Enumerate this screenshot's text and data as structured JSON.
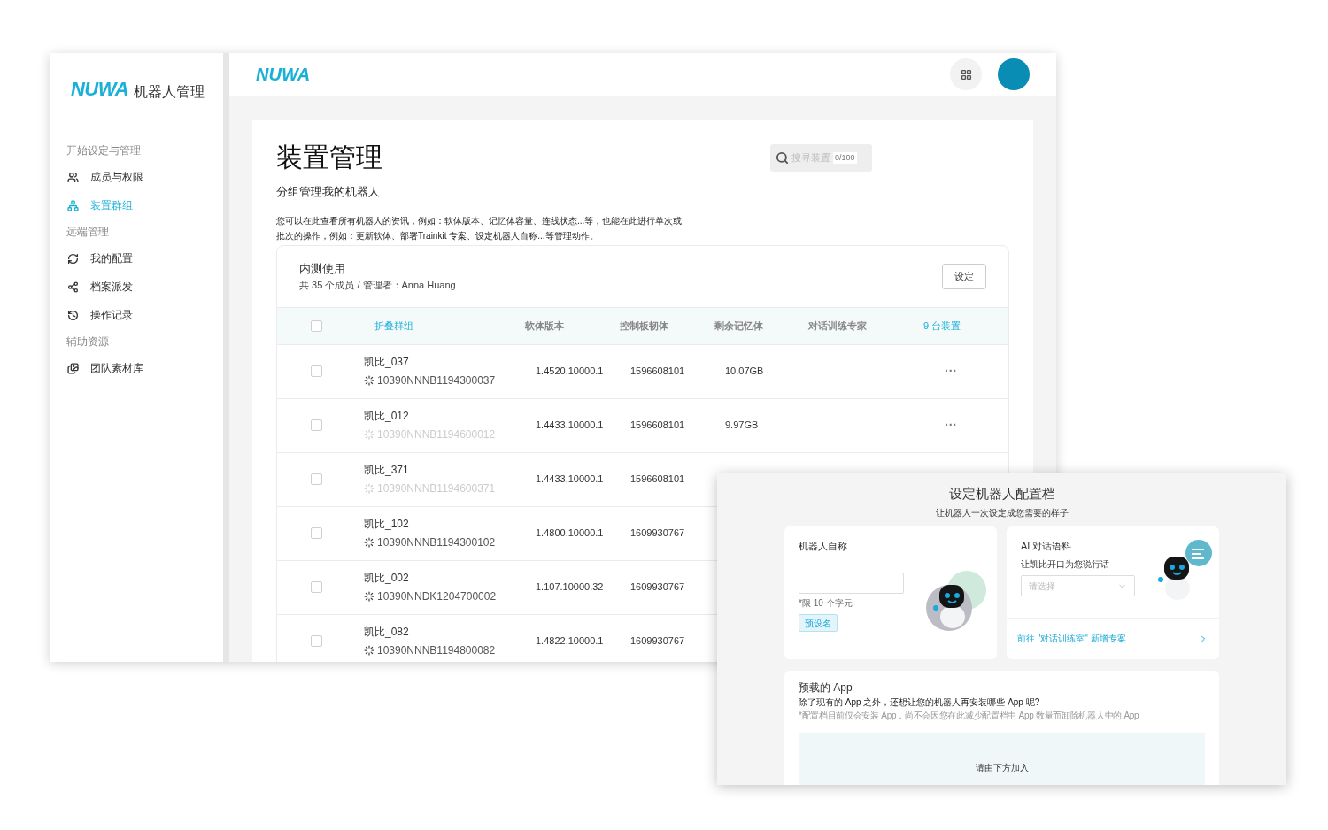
{
  "main_window": {
    "sidebar": {
      "logo": "NUWA",
      "product": "机器人管理",
      "sections": [
        {
          "title": "开始设定与管理",
          "items": [
            {
              "label": "成员与权限",
              "selected": false
            },
            {
              "label": "装置群组",
              "selected": true
            }
          ]
        },
        {
          "title": "远端管理",
          "items": [
            {
              "label": "我的配置",
              "selected": false
            },
            {
              "label": "档案派发",
              "selected": false
            },
            {
              "label": "操作记录",
              "selected": false
            }
          ]
        },
        {
          "title": "辅助资源",
          "items": [
            {
              "label": "团队素材库",
              "selected": false
            }
          ]
        }
      ]
    },
    "topbar": {
      "logo": "NUWA"
    },
    "page": {
      "title": "装置管理",
      "subtitle": "分组管理我的机器人",
      "description": [
        "您可以在此查看所有机器人的资讯，例如：软体版本、记忆体容量、连线状态...等，也能在此进行单次或",
        "批次的操作，例如：更新软体、部署Trainkit 专案、设定机器人自称...等管理动作。"
      ],
      "search": {
        "placeholder": "搜寻装置",
        "counter": "0/100"
      },
      "group": {
        "name": "内测使用",
        "meta": "共 35 个成员 / 管理者：Anna Huang",
        "button": "设定",
        "header": {
          "checked": false,
          "collapse": "折叠群组",
          "columns": [
            "软体版本",
            "控制板韧体",
            "剩余记忆体",
            "对话训练专家"
          ],
          "count": "9 台装置"
        },
        "rows": [
          {
            "checked": false,
            "name": "凯比_037",
            "device_id": "10390NNNB1194300037",
            "online": true,
            "version": "1.4520.10000.1",
            "firmware": "1596608101",
            "memory": "10.07GB",
            "more": "···"
          },
          {
            "checked": false,
            "name": "凯比_012",
            "device_id": "10390NNNB1194600012",
            "online": false,
            "version": "1.4433.10000.1",
            "firmware": "1596608101",
            "memory": "9.97GB",
            "more": "···"
          },
          {
            "checked": false,
            "name": "凯比_371",
            "device_id": "10390NNNB1194600371",
            "online": false,
            "version": "1.4433.10000.1",
            "firmware": "1596608101"
          },
          {
            "checked": false,
            "name": "凯比_102",
            "device_id": "10390NNNB1194300102",
            "online": true,
            "version": "1.4800.10000.1",
            "firmware": "1609930767"
          },
          {
            "checked": false,
            "name": "凯比_002",
            "device_id": "10390NNDK1204700002",
            "online": true,
            "version": "1.107.10000.32",
            "firmware": "1609930767"
          },
          {
            "checked": false,
            "name": "凯比_082",
            "device_id": "10390NNNB1194800082",
            "online": true,
            "version": "1.4822.10000.1",
            "firmware": "1609930767"
          }
        ]
      }
    }
  },
  "profile_window": {
    "title": "设定机器人配置档",
    "subtitle": "让机器人一次设定成您需要的样子",
    "name_card": {
      "title": "机器人自称",
      "hint": "*限 10 个字元",
      "button": "预设名"
    },
    "ai_card": {
      "title": "AI 对话语料",
      "subtitle": "让凯比开口为您说行话",
      "select": {
        "placeholder": "请选择"
      },
      "link": "前往 \"对话训练室\" 新增专案"
    },
    "apps_card": {
      "title": "预载的 App",
      "question": "除了现有的 App 之外，还想让您的机器人再安装哪些 App 呢?",
      "note": "*配置档目前仅会安装 App，尚不会因您在此减少配置档中 App 数量而卸除机器人中的 App",
      "drop_area": "请由下方加入"
    }
  }
}
